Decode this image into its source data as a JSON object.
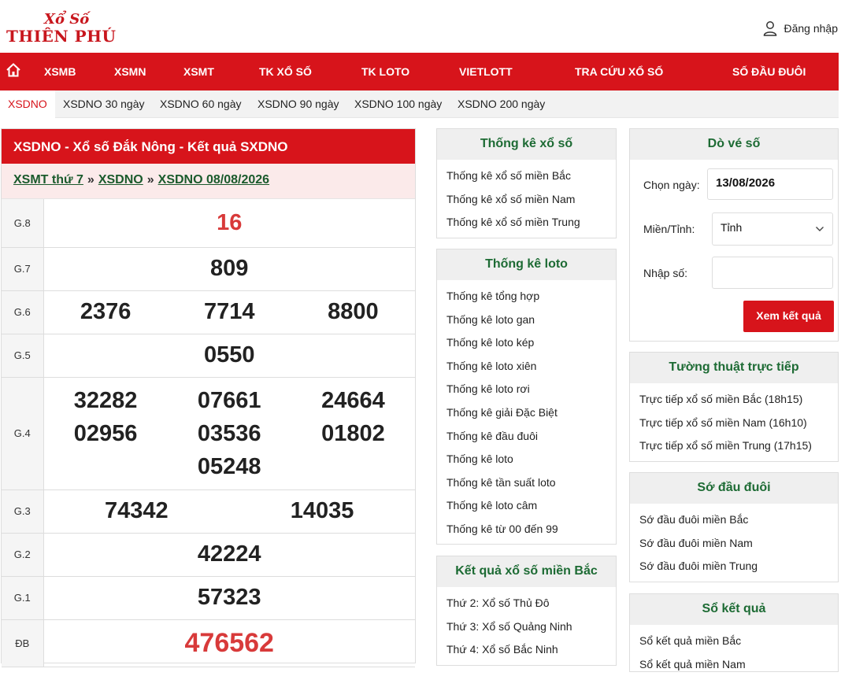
{
  "logo": {
    "top": "Xổ Số",
    "main": "THIÊN PHÚ"
  },
  "header": {
    "login": "Đăng nhập"
  },
  "nav": [
    "XSMB",
    "XSMN",
    "XSMT",
    "TK XỔ SỐ",
    "TK LOTO",
    "VIETLOTT",
    "TRA CỨU XỔ SỐ",
    "SỐ ĐẦU ĐUÔI"
  ],
  "subnav": [
    "XSDNO",
    "XSDNO 30 ngày",
    "XSDNO 60 ngày",
    "XSDNO 90 ngày",
    "XSDNO 100 ngày",
    "XSDNO 200 ngày"
  ],
  "result": {
    "title": "XSDNO - Xổ số Đắk Nông - Kết quả SXDNO",
    "crumbs": [
      "XSMT thứ 7",
      "XSDNO",
      "XSDNO 08/08/2026"
    ],
    "crumb_sep": "»",
    "rows": [
      {
        "label": "G.8",
        "numbers": [
          "16"
        ]
      },
      {
        "label": "G.7",
        "numbers": [
          "809"
        ]
      },
      {
        "label": "G.6",
        "numbers": [
          "2376",
          "7714",
          "8800"
        ]
      },
      {
        "label": "G.5",
        "numbers": [
          "0550"
        ]
      },
      {
        "label": "G.4",
        "numbers": [
          "32282",
          "07661",
          "24664",
          "02956",
          "03536",
          "01802",
          "05248"
        ]
      },
      {
        "label": "G.3",
        "numbers": [
          "74342",
          "14035"
        ]
      },
      {
        "label": "G.2",
        "numbers": [
          "42224"
        ]
      },
      {
        "label": "G.1",
        "numbers": [
          "57323"
        ]
      },
      {
        "label": "ĐB",
        "numbers": [
          "476562"
        ]
      }
    ]
  },
  "tk_xoso": {
    "title": "Thống kê xổ số",
    "items": [
      "Thống kê xổ số miền Bắc",
      "Thống kê xổ số miền Nam",
      "Thống kê xổ số miền Trung"
    ]
  },
  "tk_loto": {
    "title": "Thống kê loto",
    "items": [
      "Thống kê tổng hợp",
      "Thống kê loto gan",
      "Thống kê loto kép",
      "Thống kê loto xiên",
      "Thống kê loto rơi",
      "Thống kê giải Đặc Biệt",
      "Thống kê đầu đuôi",
      "Thống kê loto",
      "Thống kê tần suất loto",
      "Thống kê loto câm",
      "Thống kê từ 00 đến 99"
    ]
  },
  "kq_mb": {
    "title": "Kết quả xổ số miền Bắc",
    "items": [
      "Thứ 2: Xổ số Thủ Đô",
      "Thứ 3: Xổ số Quảng Ninh",
      "Thứ 4: Xổ số Bắc Ninh"
    ]
  },
  "dove": {
    "title": "Dò vé số",
    "date_label": "Chọn ngày:",
    "date_value": "13/08/2026",
    "region_label": "Miền/Tỉnh:",
    "region_value": "Tỉnh",
    "number_label": "Nhập số:",
    "number_value": "",
    "button": "Xem kết quả"
  },
  "tuongthuat": {
    "title": "Tường thuật trực tiếp",
    "items": [
      "Trực tiếp xổ số miền Bắc (18h15)",
      "Trực tiếp xổ số miền Nam (16h10)",
      "Trực tiếp xổ số miền Trung (17h15)"
    ]
  },
  "daudui": {
    "title": "Sớ đầu đuôi",
    "items": [
      "Sớ đầu đuôi miền Bắc",
      "Sớ đầu đuôi miền Nam",
      "Sớ đầu đuôi miền Trung"
    ]
  },
  "soketqua": {
    "title": "Sổ kết quả",
    "items": [
      "Sổ kết quả miền Bắc",
      "Sổ kết quả miền Nam"
    ]
  },
  "colors": {
    "brand_red": "#d7141b",
    "heading_green": "#1d6b34",
    "prize_red": "#d83a3a"
  },
  "icons": {
    "home": "home-icon",
    "user": "user-icon",
    "dropdown": "chevron-down-icon"
  }
}
